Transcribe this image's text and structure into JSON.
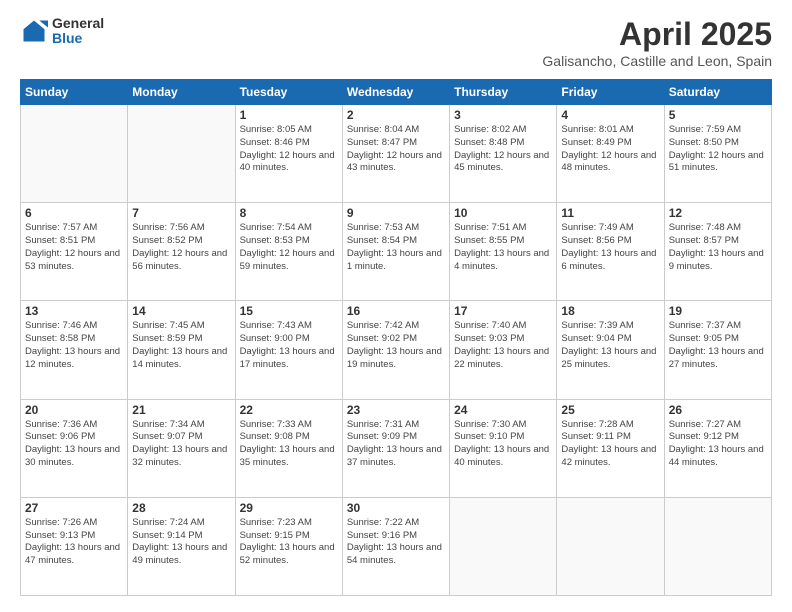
{
  "logo": {
    "general": "General",
    "blue": "Blue"
  },
  "title": "April 2025",
  "subtitle": "Galisancho, Castille and Leon, Spain",
  "headers": [
    "Sunday",
    "Monday",
    "Tuesday",
    "Wednesday",
    "Thursday",
    "Friday",
    "Saturday"
  ],
  "weeks": [
    [
      {
        "day": "",
        "info": ""
      },
      {
        "day": "",
        "info": ""
      },
      {
        "day": "1",
        "info": "Sunrise: 8:05 AM\nSunset: 8:46 PM\nDaylight: 12 hours and 40 minutes."
      },
      {
        "day": "2",
        "info": "Sunrise: 8:04 AM\nSunset: 8:47 PM\nDaylight: 12 hours and 43 minutes."
      },
      {
        "day": "3",
        "info": "Sunrise: 8:02 AM\nSunset: 8:48 PM\nDaylight: 12 hours and 45 minutes."
      },
      {
        "day": "4",
        "info": "Sunrise: 8:01 AM\nSunset: 8:49 PM\nDaylight: 12 hours and 48 minutes."
      },
      {
        "day": "5",
        "info": "Sunrise: 7:59 AM\nSunset: 8:50 PM\nDaylight: 12 hours and 51 minutes."
      }
    ],
    [
      {
        "day": "6",
        "info": "Sunrise: 7:57 AM\nSunset: 8:51 PM\nDaylight: 12 hours and 53 minutes."
      },
      {
        "day": "7",
        "info": "Sunrise: 7:56 AM\nSunset: 8:52 PM\nDaylight: 12 hours and 56 minutes."
      },
      {
        "day": "8",
        "info": "Sunrise: 7:54 AM\nSunset: 8:53 PM\nDaylight: 12 hours and 59 minutes."
      },
      {
        "day": "9",
        "info": "Sunrise: 7:53 AM\nSunset: 8:54 PM\nDaylight: 13 hours and 1 minute."
      },
      {
        "day": "10",
        "info": "Sunrise: 7:51 AM\nSunset: 8:55 PM\nDaylight: 13 hours and 4 minutes."
      },
      {
        "day": "11",
        "info": "Sunrise: 7:49 AM\nSunset: 8:56 PM\nDaylight: 13 hours and 6 minutes."
      },
      {
        "day": "12",
        "info": "Sunrise: 7:48 AM\nSunset: 8:57 PM\nDaylight: 13 hours and 9 minutes."
      }
    ],
    [
      {
        "day": "13",
        "info": "Sunrise: 7:46 AM\nSunset: 8:58 PM\nDaylight: 13 hours and 12 minutes."
      },
      {
        "day": "14",
        "info": "Sunrise: 7:45 AM\nSunset: 8:59 PM\nDaylight: 13 hours and 14 minutes."
      },
      {
        "day": "15",
        "info": "Sunrise: 7:43 AM\nSunset: 9:00 PM\nDaylight: 13 hours and 17 minutes."
      },
      {
        "day": "16",
        "info": "Sunrise: 7:42 AM\nSunset: 9:02 PM\nDaylight: 13 hours and 19 minutes."
      },
      {
        "day": "17",
        "info": "Sunrise: 7:40 AM\nSunset: 9:03 PM\nDaylight: 13 hours and 22 minutes."
      },
      {
        "day": "18",
        "info": "Sunrise: 7:39 AM\nSunset: 9:04 PM\nDaylight: 13 hours and 25 minutes."
      },
      {
        "day": "19",
        "info": "Sunrise: 7:37 AM\nSunset: 9:05 PM\nDaylight: 13 hours and 27 minutes."
      }
    ],
    [
      {
        "day": "20",
        "info": "Sunrise: 7:36 AM\nSunset: 9:06 PM\nDaylight: 13 hours and 30 minutes."
      },
      {
        "day": "21",
        "info": "Sunrise: 7:34 AM\nSunset: 9:07 PM\nDaylight: 13 hours and 32 minutes."
      },
      {
        "day": "22",
        "info": "Sunrise: 7:33 AM\nSunset: 9:08 PM\nDaylight: 13 hours and 35 minutes."
      },
      {
        "day": "23",
        "info": "Sunrise: 7:31 AM\nSunset: 9:09 PM\nDaylight: 13 hours and 37 minutes."
      },
      {
        "day": "24",
        "info": "Sunrise: 7:30 AM\nSunset: 9:10 PM\nDaylight: 13 hours and 40 minutes."
      },
      {
        "day": "25",
        "info": "Sunrise: 7:28 AM\nSunset: 9:11 PM\nDaylight: 13 hours and 42 minutes."
      },
      {
        "day": "26",
        "info": "Sunrise: 7:27 AM\nSunset: 9:12 PM\nDaylight: 13 hours and 44 minutes."
      }
    ],
    [
      {
        "day": "27",
        "info": "Sunrise: 7:26 AM\nSunset: 9:13 PM\nDaylight: 13 hours and 47 minutes."
      },
      {
        "day": "28",
        "info": "Sunrise: 7:24 AM\nSunset: 9:14 PM\nDaylight: 13 hours and 49 minutes."
      },
      {
        "day": "29",
        "info": "Sunrise: 7:23 AM\nSunset: 9:15 PM\nDaylight: 13 hours and 52 minutes."
      },
      {
        "day": "30",
        "info": "Sunrise: 7:22 AM\nSunset: 9:16 PM\nDaylight: 13 hours and 54 minutes."
      },
      {
        "day": "",
        "info": ""
      },
      {
        "day": "",
        "info": ""
      },
      {
        "day": "",
        "info": ""
      }
    ]
  ]
}
